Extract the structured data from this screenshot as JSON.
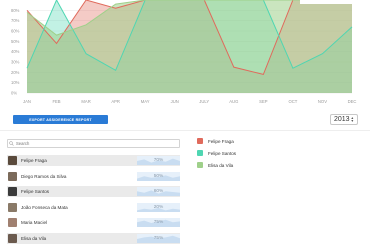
{
  "chart_data": {
    "type": "area",
    "categories": [
      "JAN",
      "FEB",
      "MAR",
      "APR",
      "MAY",
      "JUN",
      "JULY",
      "AUG",
      "SEP",
      "OCT",
      "NOV",
      "DEC"
    ],
    "y_ticks": [
      "80%",
      "70%",
      "60%",
      "50%",
      "40%",
      "30%",
      "20%",
      "10%",
      "0%"
    ],
    "ylim": [
      0,
      90
    ],
    "grid": true,
    "series": [
      {
        "name": "Felipe Fraga",
        "color": "#e06a5c",
        "values": [
          80,
          48,
          90,
          82,
          90,
          90,
          90,
          25,
          18,
          90,
          90,
          90
        ]
      },
      {
        "name": "Felipe Santos",
        "color": "#4fd6b2",
        "values": [
          24,
          90,
          38,
          22,
          90,
          90,
          90,
          90,
          90,
          24,
          38,
          64
        ]
      },
      {
        "name": "Elisa da Vila",
        "color": "#9fd08a",
        "values": [
          78,
          56,
          66,
          86,
          90,
          90,
          90,
          90,
          90,
          90,
          90,
          90
        ]
      }
    ]
  },
  "export_button": "EXPORT ASSIDERENCE REPORT",
  "year_select": "2013",
  "search": {
    "placeholder": "Search"
  },
  "users": [
    {
      "name": "Felipe Fraga",
      "value": "70%",
      "avatar_color": "#5a4a3c",
      "shaded": true,
      "spark": [
        0.5,
        0.7,
        0.3,
        0.6,
        0.4,
        0.8,
        0.5
      ]
    },
    {
      "name": "Diego Ramos da Silva",
      "value": "50%",
      "avatar_color": "#7b6a5a",
      "shaded": false,
      "spark": [
        0.3,
        0.6,
        0.4,
        0.5,
        0.7,
        0.4,
        0.6
      ]
    },
    {
      "name": "Felipe Santos",
      "value": "60%",
      "avatar_color": "#3b3b3b",
      "shaded": true,
      "spark": [
        0.6,
        0.4,
        0.7,
        0.3,
        0.6,
        0.5,
        0.4
      ]
    },
    {
      "name": "João Fonseca da Mata",
      "value": "20%",
      "avatar_color": "#8a7a68",
      "shaded": false,
      "spark": [
        0.2,
        0.4,
        0.3,
        0.5,
        0.2,
        0.4,
        0.3
      ]
    },
    {
      "name": "Maria Maciel",
      "value": "75%",
      "avatar_color": "#a08070",
      "shaded": false,
      "spark": [
        0.6,
        0.8,
        0.5,
        0.7,
        0.9,
        0.6,
        0.7
      ]
    },
    {
      "name": "Elisa da Vila",
      "value": "75%",
      "avatar_color": "#6b5a4e",
      "shaded": true,
      "spark": [
        0.5,
        0.7,
        0.8,
        0.6,
        0.7,
        0.9,
        0.6
      ]
    }
  ],
  "legend": [
    {
      "name": "Felipe Fraga",
      "color": "#e06a5c"
    },
    {
      "name": "Felipe Santos",
      "color": "#4fd6b2"
    },
    {
      "name": "Elisa da Vila",
      "color": "#9fd08a"
    }
  ]
}
